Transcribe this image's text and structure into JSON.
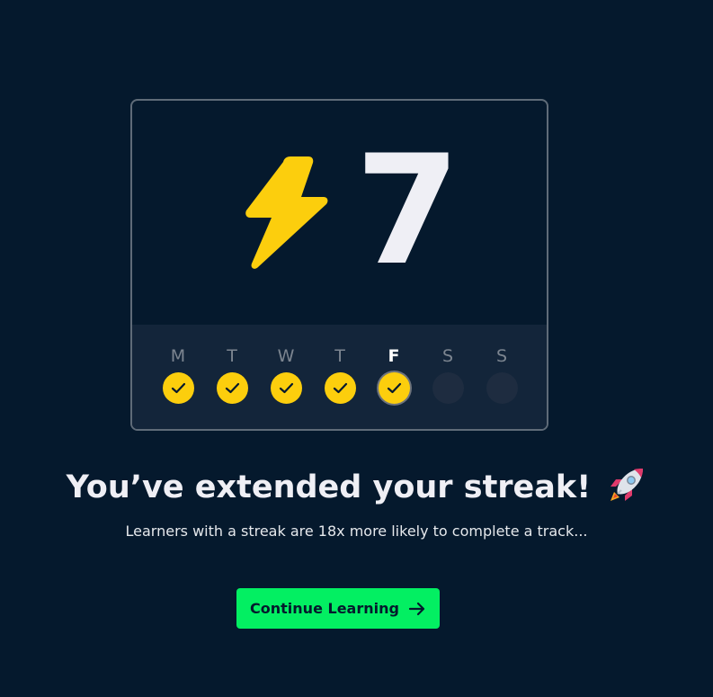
{
  "streak": {
    "count": "7",
    "icon": "lightning-bolt-icon",
    "bolt_color": "#fcce0d"
  },
  "week": [
    {
      "label": "M",
      "completed": true,
      "current": false
    },
    {
      "label": "T",
      "completed": true,
      "current": false
    },
    {
      "label": "W",
      "completed": true,
      "current": false
    },
    {
      "label": "T",
      "completed": true,
      "current": false
    },
    {
      "label": "F",
      "completed": true,
      "current": true
    },
    {
      "label": "S",
      "completed": false,
      "current": false
    },
    {
      "label": "S",
      "completed": false,
      "current": false
    }
  ],
  "headline": {
    "text": "You’ve extended your streak!",
    "icon": "rocket-icon"
  },
  "subtext": "Learners with a streak are 18x more likely to complete a track...",
  "cta": {
    "label": "Continue Learning",
    "icon": "arrow-right-icon",
    "color": "#03ef62"
  },
  "colors": {
    "background": "#05192d",
    "accent_yellow": "#fcce0d",
    "accent_green": "#03ef62"
  }
}
